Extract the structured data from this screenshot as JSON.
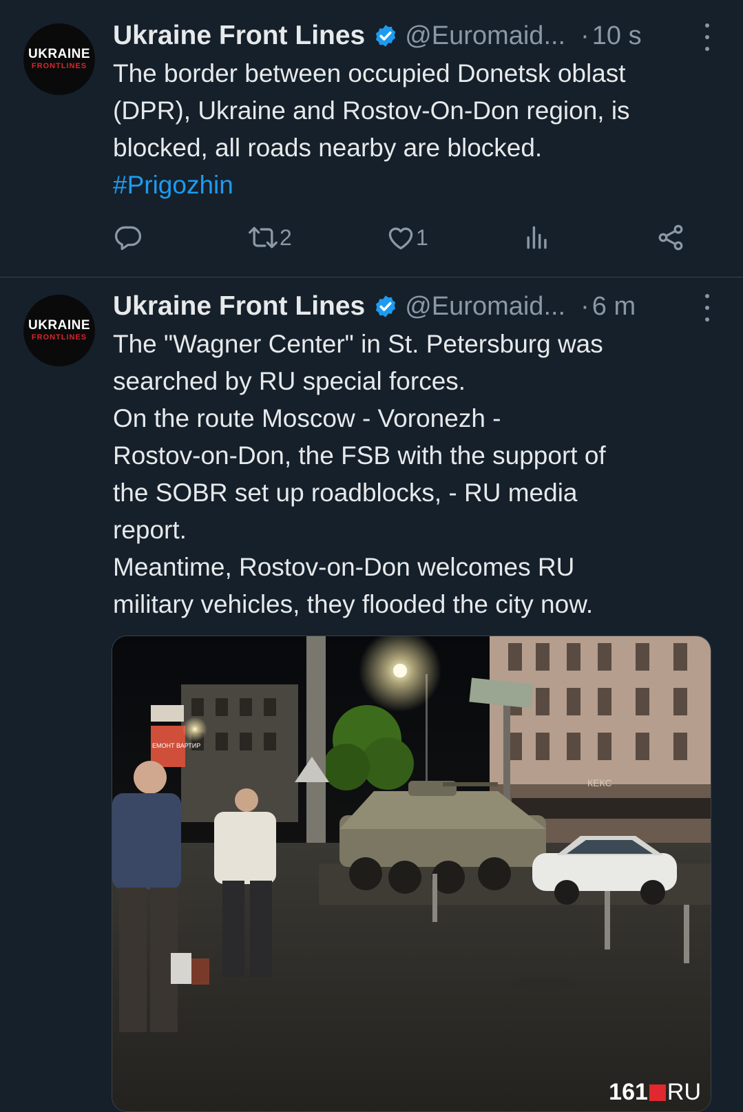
{
  "tweets": [
    {
      "avatar": {
        "line1": "UKRAINE",
        "line2": "FRONTLINES"
      },
      "name": "Ukraine Front Lines",
      "handle": "@Euromaid...",
      "time": "10 s",
      "text_lines": [
        "The border between occupied Donetsk oblast",
        "(DPR), Ukraine and Rostov-On-Don region, is",
        "blocked, all roads nearby are blocked."
      ],
      "hashtag": "#Prigozhin",
      "actions": {
        "retweets": "2",
        "likes": "1"
      }
    },
    {
      "avatar": {
        "line1": "UKRAINE",
        "line2": "FRONTLINES"
      },
      "name": "Ukraine Front Lines",
      "handle": "@Euromaid...",
      "time": "6 m",
      "text_lines": [
        "The \"Wagner Center\" in St. Petersburg was",
        "searched by RU special forces.",
        "On the route Moscow - Voronezh -",
        "Rostov-on-Don, the FSB with the support of",
        "the SOBR set up roadblocks, - RU media",
        "report.",
        "Meantime, Rostov-on-Don welcomes RU",
        "military vehicles, they flooded the city now."
      ],
      "media": {
        "watermark": {
          "num": "161",
          "suffix": "RU"
        },
        "storefront_sign": "КЕКС",
        "shop_sign": "ЕМОНТ ВАРТИР"
      }
    }
  ],
  "colors": {
    "bg": "#15202b",
    "text": "#e7e9ea",
    "muted": "#8b98a5",
    "link": "#1d9bf0",
    "verified": "#1d9bf0",
    "divider": "#38444d"
  },
  "icons": [
    "verified-badge-icon",
    "more-icon",
    "reply-icon",
    "retweet-icon",
    "like-icon",
    "views-icon",
    "share-icon"
  ]
}
